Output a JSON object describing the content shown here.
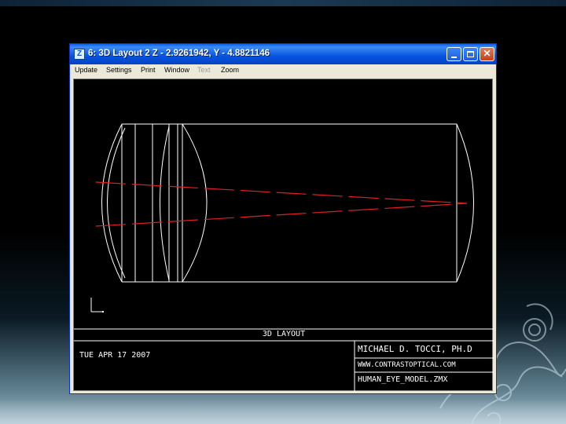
{
  "window": {
    "title": "6: 3D Layout 2 Z - 2.9261942, Y - 4.8821146",
    "app_icon_glyph": "Z",
    "controls": {
      "minimize_icon": "minimize-icon",
      "maximize_icon": "maximize-icon",
      "close_icon": "close-icon"
    }
  },
  "menu": {
    "items": [
      {
        "label": "Update",
        "enabled": true
      },
      {
        "label": "Settings",
        "enabled": true
      },
      {
        "label": "Print",
        "enabled": true
      },
      {
        "label": "Window",
        "enabled": true
      },
      {
        "label": "Text",
        "enabled": false
      },
      {
        "label": "Zoom",
        "enabled": true
      }
    ]
  },
  "plot": {
    "caption": "3D LAYOUT",
    "date": "TUE APR 17 2007",
    "author": "MICHAEL D. TOCCI, PH.D",
    "website": "WWW.CONTRASTOPTICAL.COM",
    "filename": "HUMAN_EYE_MODEL.ZMX",
    "line_color": "#ffffff",
    "ray_color": "#e02020"
  },
  "colors": {
    "titlebar": "#0753e0",
    "window_bg": "#ece9d8",
    "canvas_bg": "#000000"
  }
}
